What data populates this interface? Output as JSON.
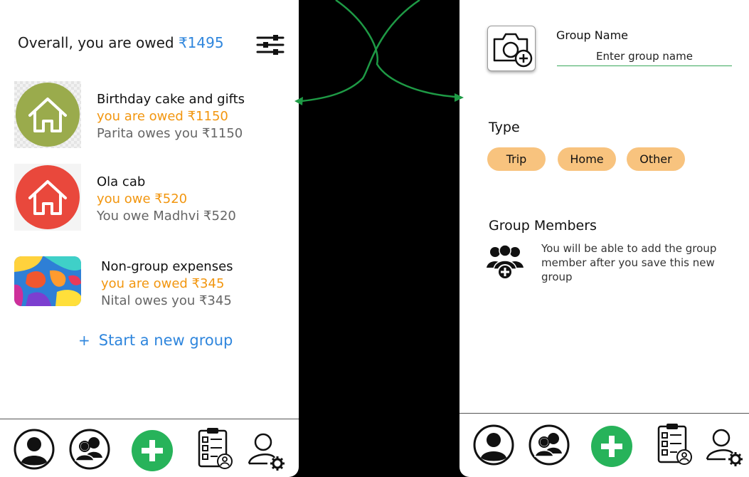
{
  "left_screen": {
    "overall": {
      "prefix": "Overall, you are owed ",
      "amount": "₹1495"
    },
    "groups": [
      {
        "name": "Birthday cake and gifts",
        "status": "you are owed ₹1150",
        "detail": "Parita owes you ₹1150",
        "icon": "house-icon",
        "color": "#9aab4c"
      },
      {
        "name": "Ola cab",
        "status": "you owe ₹520",
        "detail": "You owe Madhvi ₹520",
        "icon": "house-icon",
        "color": "#e9483c"
      },
      {
        "name": "Non-group expenses",
        "status": "you are owed ₹345",
        "detail": "Nital owes you ₹345",
        "icon": "colorful-camo-icon"
      }
    ],
    "new_group": {
      "plus": "+",
      "label": "Start a new group"
    }
  },
  "right_screen": {
    "group_name_label": "Group Name",
    "group_name_placeholder": "Enter group name",
    "type_label": "Type",
    "type_options": [
      "Trip",
      "Home",
      "Other"
    ],
    "members_label": "Group Members",
    "members_note": "You will be able to add the group member after you save this new group"
  },
  "bottom_nav": [
    "profile-icon",
    "friends-icon",
    "add-expense-icon",
    "activity-checklist-icon",
    "account-settings-icon"
  ],
  "colors": {
    "accent_blue": "#2f86dd",
    "owe_orange": "#f2960f",
    "add_green": "#27b35a",
    "pill_orange": "#f8c37e",
    "arrow_green": "#1e9a45"
  }
}
